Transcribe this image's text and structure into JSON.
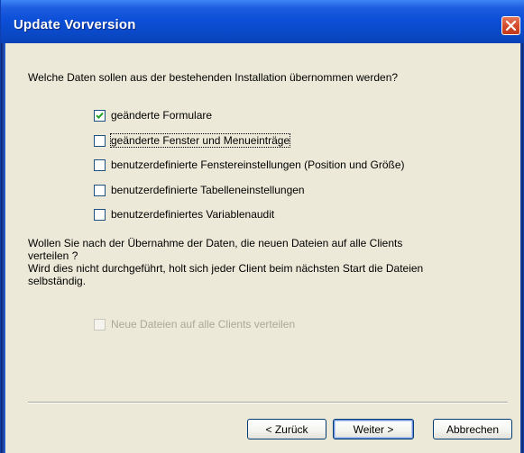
{
  "window": {
    "title": "Update Vorversion"
  },
  "question": "Welche Daten sollen aus der bestehenden Installation übernommen werden?",
  "options": [
    {
      "label": "geänderte Formulare",
      "checked": true
    },
    {
      "label": "geänderte Fenster und Menueinträge",
      "checked": false
    },
    {
      "label": "benutzerdefinierte Fenstereinstellungen (Position und Größe)",
      "checked": false
    },
    {
      "label": "benutzerdefinierte Tabelleneinstellungen",
      "checked": false
    },
    {
      "label": "benutzerdefiniertes Variablenaudit",
      "checked": false
    }
  ],
  "distribute": {
    "line1": "Wollen Sie nach der Übernahme der Daten, die neuen Dateien auf alle Clients",
    "line2": "verteilen ?",
    "line3": "Wird dies nicht durchgeführt, holt sich jeder Client beim nächsten Start die Dateien",
    "line4": "selbständig.",
    "checkbox_label": "Neue Dateien auf alle Clients verteilen"
  },
  "buttons": {
    "back": "< Zurück",
    "next": "Weiter >",
    "cancel": "Abbrechen"
  },
  "colors": {
    "title_bar": "#0a49c8",
    "dialog_background": "#ece9d8",
    "close_button": "#d14a2a"
  }
}
